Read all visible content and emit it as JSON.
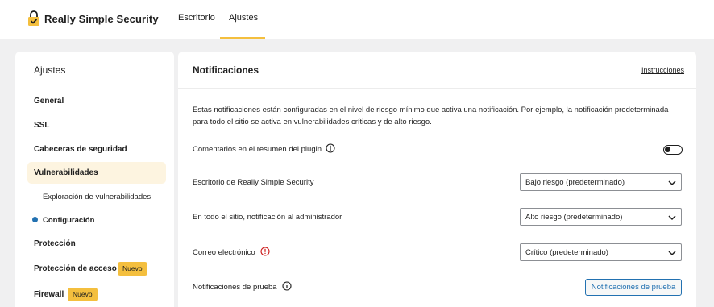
{
  "header": {
    "brand": "Really Simple Security",
    "tabs": [
      {
        "label": "Escritorio"
      },
      {
        "label": "Ajustes"
      }
    ],
    "accent_color": "#f4bf3e"
  },
  "sidebar": {
    "title": "Ajustes",
    "items": [
      {
        "label": "General"
      },
      {
        "label": "SSL"
      },
      {
        "label": "Cabeceras de seguridad"
      },
      {
        "label": "Vulnerabilidades"
      },
      {
        "label": "Protección"
      },
      {
        "label": "Protección de acceso",
        "badge": "Nuevo"
      },
      {
        "label": "Firewall",
        "badge": "Nuevo"
      }
    ],
    "subitems": [
      {
        "label": "Exploración de vulnerabilidades"
      },
      {
        "label": "Configuración"
      }
    ]
  },
  "main": {
    "title": "Notificaciones",
    "help_link": "Instrucciones",
    "description": "Estas notificaciones están configuradas en el nivel de riesgo mínimo que activa una notificación. Por ejemplo, la notificación predeterminada para todo el sitio se activa en vulnerabilidades críticas y de alto riesgo.",
    "rows": [
      {
        "label": "Comentarios en el resumen del plugin",
        "control": "toggle",
        "checked": false
      },
      {
        "label": "Escritorio de Really Simple Security",
        "value": "Bajo riesgo (predeterminado)"
      },
      {
        "label": "En todo el sitio, notificación al administrador",
        "value": "Alto riesgo (predeterminado)"
      },
      {
        "label": "Correo electrónico",
        "value": "Crítico (predeterminado)"
      },
      {
        "label": "Notificaciones de prueba",
        "button": "Notificaciones de prueba"
      }
    ]
  }
}
